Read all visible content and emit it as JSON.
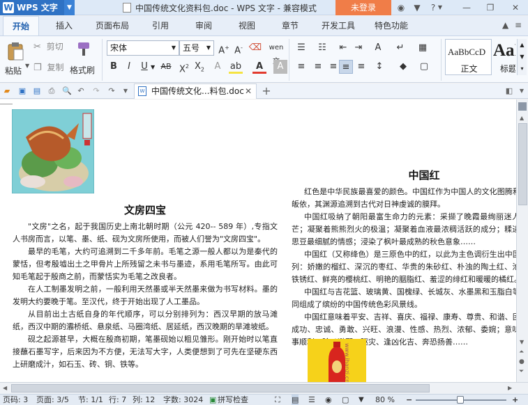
{
  "titlebar": {
    "app_menu": "WPS 文字",
    "document_title": "中国传统文化资料包.doc - WPS 文字 - 兼容模式",
    "login": "未登录"
  },
  "tabs": [
    "开始",
    "插入",
    "页面布局",
    "引用",
    "审阅",
    "视图",
    "章节",
    "开发工具",
    "特色功能"
  ],
  "ribbon": {
    "paste": "粘贴",
    "cut": "剪切",
    "copy": "复制",
    "format_painter": "格式刷",
    "font_name": "宋体",
    "font_size": "五号",
    "styles": [
      {
        "preview": "AaBbCcD",
        "name": "正文"
      },
      {
        "preview": "AaI",
        "name": "标题 1"
      }
    ]
  },
  "doc_tab": "中国传统文化...料包.doc",
  "document": {
    "left": {
      "title": "文房四宝",
      "paragraphs": [
        "\"文房\"之名，起于我国历史上南北朝时期（公元 420-- 589 年）,专指文人书房而言，以笔、墨、纸、砚为文房所使用，而被人们誉为\"文房四宝\"。",
        "最早的毛笔，大约可追溯到二千多年前。毛笔之源一般人都以为是秦代的蒙恬，但考殷墟出土之甲骨片上所残留之未书与墨迹，系用毛笔所写。由此可知毛笔起于殷商之前，而蒙恬实为毛笔之改良者。",
        "在人工制墨发明之前，一般利用天然墨或半天然墨来做为书写材料。墨的发明大约要晚于笔。至汉代，终于开始出现了人工墨品。",
        "从目前出土古纸自身的年代顺序，可以分别排列为：西汉早期的放马滩纸，西汉中期的灞桥纸、悬泉纸、马圈湾纸、居延纸，西汉晚期的旱滩坡纸。",
        "砚之起源甚早，大概在殷商初期，笔墨砚始以粗见雏形。刚开始时以笔直接蘸石墨写字，后来因为不方便，无法写大字，人类便想到了可先在坚硬东西上研磨成汁，如石玉、砖、铜、铁等。"
      ]
    },
    "right": {
      "title": "中国红",
      "paragraphs": [
        "红色是中华民族最喜爱的颜色。中国红作为中国人的文化图腾和精神皈依，其渊源追溯到古代对日神虔诚的膜拜。",
        "中国红吸纳了朝阳最富生命力的元素：采撷了晚霞最绚丽迷人的光芒；凝聚着熊熊烈火的极温；凝聚着血液最浓稠活跃的成分；糅进了相思豆最细腻的情感；浸染了枫叶最成熟的秋色意象……",
        "中国红（又称绛色）是三原色中的红，以此为主色调衍生出中国红系列：娇嫩的榴红、深沉的枣红、华贵的朱砂红、朴浊的陶土红、沧桑的铁锈红、鲜亮的樱桃红、明艳的胭脂红、羞涩的绯红和暖暖的橘红。",
        "中国红与吉花篮、玻璃黄、国槐绿、长城灰、水墨黑和玉脂白等，共同组成了缤纷的中国传统色彩风景线。",
        "中国红意味着平安、吉祥、喜庆、福禄、康寿、尊贵、和谐、团圆、成功、忠诚、勇敢、兴旺、浪漫、性感、热烈、浓郁、委婉；意味着百事顺利、除凶避邪、驱灾、逢凶化吉、奔恐扬善……"
      ],
      "image_watermark": "www.ihanzi.cn"
    }
  },
  "status": {
    "page_count": "页码: 3",
    "page": "页面: 3/5",
    "section": "节: 1/1",
    "line": "行: 7",
    "column": "列: 12",
    "word_count": "字数: 3024",
    "spellcheck": "拼写检查",
    "zoom": "80 %",
    "zoom_percent": 80
  },
  "colors": {
    "accent": "#2f72c4",
    "login": "#f07d48",
    "tab_active": "#1f5fae"
  }
}
